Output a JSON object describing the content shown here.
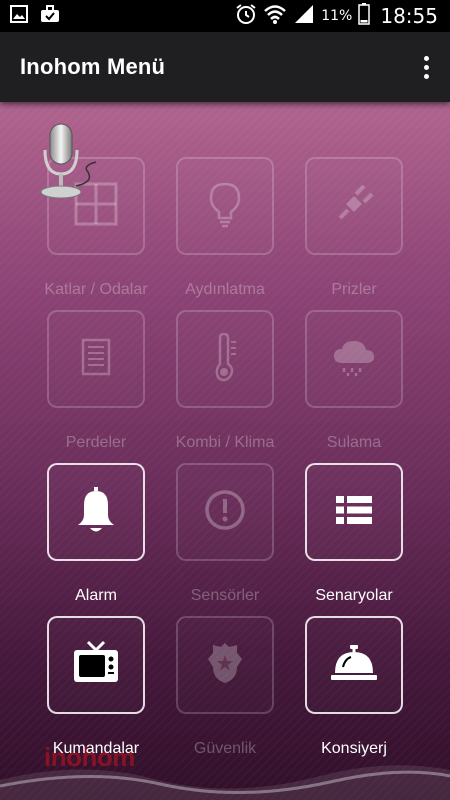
{
  "status_bar": {
    "time": "18:55",
    "battery_percent": "11%",
    "icons": [
      "gallery-icon",
      "briefcase-icon",
      "alarm-icon",
      "wifi-icon",
      "signal-icon",
      "battery-icon"
    ]
  },
  "app_bar": {
    "title": "Inohom Menü"
  },
  "watermark": "inohom",
  "tiles": [
    {
      "label": "Katlar / Odalar",
      "icon": "floor-plan-icon",
      "enabled": false
    },
    {
      "label": "Aydınlatma",
      "icon": "light-bulb-icon",
      "enabled": false
    },
    {
      "label": "Prizler",
      "icon": "plug-icon",
      "enabled": false
    },
    {
      "label": "Perdeler",
      "icon": "curtain-icon",
      "enabled": false
    },
    {
      "label": "Kombi / Klima",
      "icon": "thermometer-icon",
      "enabled": false
    },
    {
      "label": "Sulama",
      "icon": "rain-cloud-icon",
      "enabled": false
    },
    {
      "label": "Alarm",
      "icon": "bell-icon",
      "enabled": true
    },
    {
      "label": "Sensörler",
      "icon": "alert-circle-icon",
      "enabled": false
    },
    {
      "label": "Senaryolar",
      "icon": "list-icon",
      "enabled": true
    },
    {
      "label": "Kumandalar",
      "icon": "tv-icon",
      "enabled": true
    },
    {
      "label": "Güvenlik",
      "icon": "police-badge-icon",
      "enabled": false
    },
    {
      "label": "Konsiyerj",
      "icon": "service-bell-icon",
      "enabled": true
    }
  ],
  "colors": {
    "app_bar": "#1f1f21",
    "background_top": "#b0648e",
    "background_bottom": "#300f29",
    "active_text": "#ffffff"
  }
}
